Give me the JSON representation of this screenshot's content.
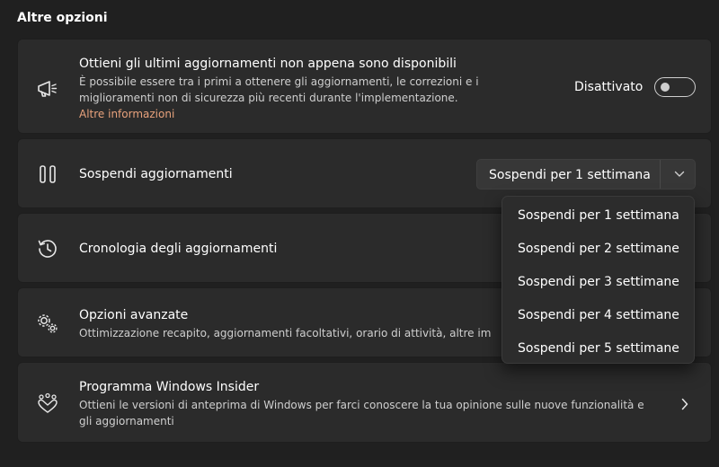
{
  "section_title": "Altre opzioni",
  "latest_updates": {
    "title": "Ottieni gli ultimi aggiornamenti non appena sono disponibili",
    "desc_line1": "È possibile essere tra i primi a ottenere gli aggiornamenti, le correzioni e i",
    "desc_line2": "miglioramenti non di sicurezza più recenti durante l'implementazione.",
    "link": "Altre informazioni",
    "toggle_label": "Disattivato",
    "toggle_on": false,
    "icon": "megaphone-icon"
  },
  "pause_updates": {
    "title": "Sospendi aggiornamenti",
    "selected": "Sospendi per 1 settimana",
    "icon": "pause-icon",
    "options": [
      "Sospendi per 1 settimana",
      "Sospendi per 2 settimane",
      "Sospendi per 3 settimane",
      "Sospendi per 4 settimane",
      "Sospendi per 5 settimane"
    ]
  },
  "history": {
    "title": "Cronologia degli aggiornamenti",
    "icon": "history-icon"
  },
  "advanced": {
    "title": "Opzioni avanzate",
    "desc": "Ottimizzazione recapito, aggiornamenti facoltativi, orario di attività, altre im",
    "icon": "gears-icon"
  },
  "insider": {
    "title": "Programma Windows Insider",
    "desc_line1": "Ottieni le versioni di anteprima di Windows per farci conoscere la tua opinione sulle nuove funzionalità e",
    "desc_line2": "gli aggiornamenti",
    "icon": "insider-hearts-icon"
  },
  "colors": {
    "background": "#202020",
    "card": "#2b2b2b",
    "link": "#e8a27c"
  }
}
